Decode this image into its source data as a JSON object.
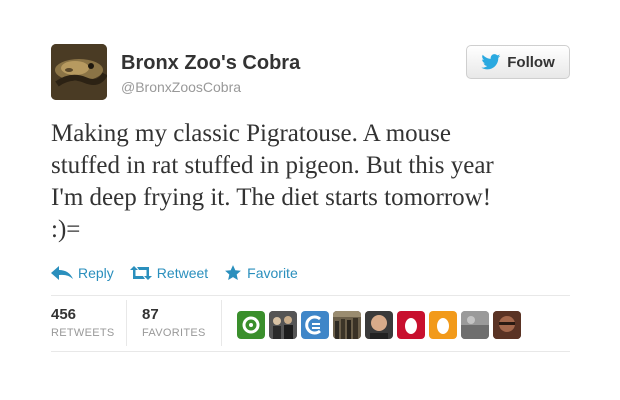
{
  "user": {
    "display_name": "Bronx Zoo's Cobra",
    "screen_name": "@BronxZoosCobra",
    "avatar_icon": "cobra-photo-icon"
  },
  "follow_button": {
    "label": "Follow",
    "icon": "twitter-bird-icon",
    "icon_color": "#2aa9e0"
  },
  "tweet": {
    "text": "Making my classic Pigratouse. A mouse\nstuffed in rat stuffed in pigeon. But this year\nI'm deep frying it. The diet starts tomorrow!\n:)="
  },
  "actions": [
    {
      "label": "Reply",
      "icon": "reply-arrow-icon"
    },
    {
      "label": "Retweet",
      "icon": "retweet-icon"
    },
    {
      "label": "Favorite",
      "icon": "star-icon"
    }
  ],
  "stats": {
    "retweets": {
      "count": "456",
      "label": "RETWEETS"
    },
    "favorites": {
      "count": "87",
      "label": "FAVORITES"
    }
  },
  "favoriter_avatars": [
    {
      "icon": "green-circle-avatar-icon",
      "color": "#3a8f2c"
    },
    {
      "icon": "group-photo-avatar-icon",
      "color": "#4a4a4a"
    },
    {
      "icon": "blue-logo-avatar-icon",
      "color": "#3f86c8"
    },
    {
      "icon": "crowd-photo-avatar-icon",
      "color": "#5a5040"
    },
    {
      "icon": "man-photo-avatar-icon",
      "color": "#c9a184"
    },
    {
      "icon": "default-egg-avatar-icon",
      "color": "#c8102e"
    },
    {
      "icon": "default-egg-avatar-icon",
      "color": "#f29a1a"
    },
    {
      "icon": "gray-photo-avatar-icon",
      "color": "#8a8a8a"
    },
    {
      "icon": "brown-photo-avatar-icon",
      "color": "#6b3d2a"
    }
  ],
  "colors": {
    "link_blue": "#2a8fbd",
    "text": "#333333",
    "muted": "#999999"
  }
}
